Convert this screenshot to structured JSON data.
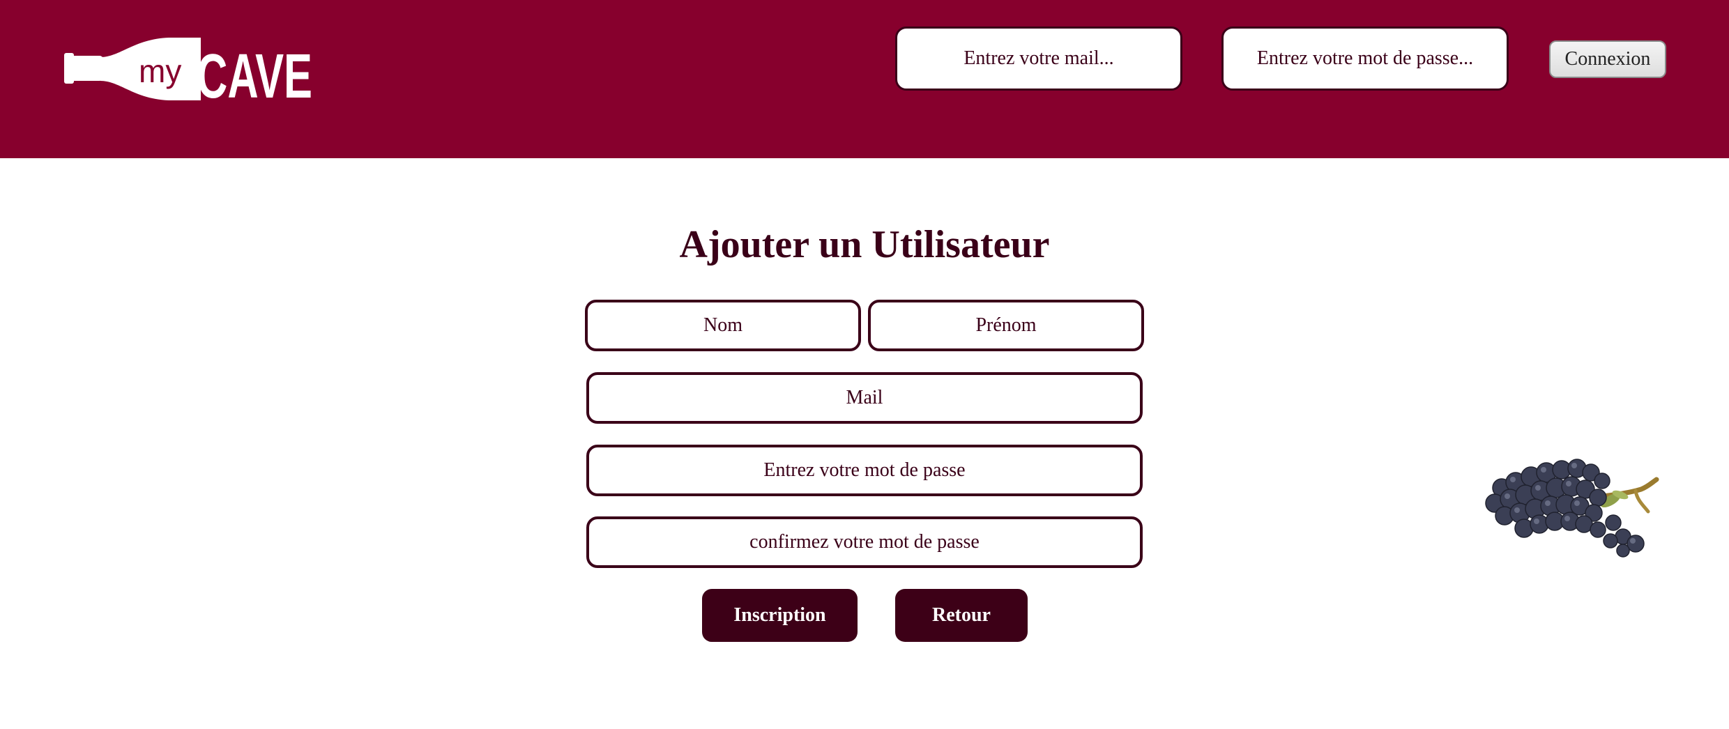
{
  "header": {
    "logo": {
      "prefix": "my",
      "name": "CAVE",
      "icon": "wine-bottle-icon"
    },
    "login": {
      "mail_placeholder": "Entrez votre mail...",
      "password_placeholder": "Entrez votre mot de passe...",
      "submit_label": "Connexion"
    }
  },
  "form": {
    "title": "Ajouter un Utilisateur",
    "fields": {
      "nom_placeholder": "Nom",
      "prenom_placeholder": "Prénom",
      "mail_placeholder": "Mail",
      "password_placeholder": "Entrez votre mot de passe",
      "confirm_placeholder": "confirmez votre mot de passe"
    },
    "buttons": {
      "inscription_label": "Inscription",
      "retour_label": "Retour"
    }
  },
  "decoration": {
    "image": "grapes-image"
  },
  "colors": {
    "header_bg": "#87002d",
    "accent_dark": "#3a0018",
    "button_bg": "#3d0017"
  }
}
